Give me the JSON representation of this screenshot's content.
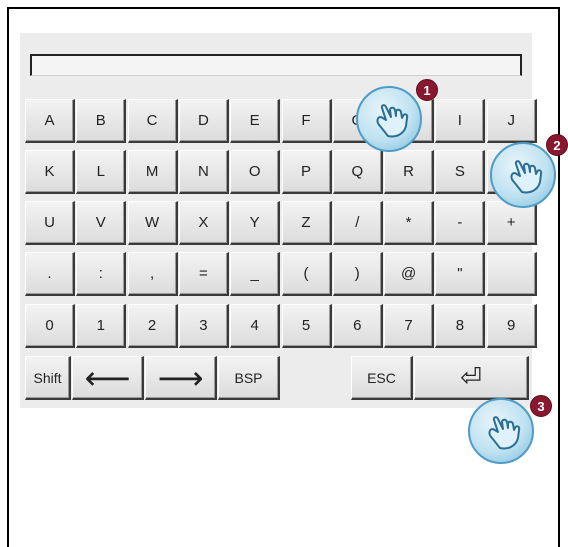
{
  "keyboard": {
    "rows": [
      [
        "A",
        "B",
        "C",
        "D",
        "E",
        "F",
        "G",
        "H",
        "I",
        "J"
      ],
      [
        "K",
        "L",
        "M",
        "N",
        "O",
        "P",
        "Q",
        "R",
        "S",
        "T"
      ],
      [
        "U",
        "V",
        "W",
        "X",
        "Y",
        "Z",
        "/",
        "*",
        "-",
        "+"
      ],
      [
        ".",
        ":",
        ",",
        "=",
        "_",
        "(",
        ")",
        "@",
        "\"",
        ""
      ],
      [
        "0",
        "1",
        "2",
        "3",
        "4",
        "5",
        "6",
        "7",
        "8",
        "9"
      ]
    ],
    "bottom_row": {
      "shift": "Shift",
      "left_arrow": "⟵",
      "right_arrow": "⟶",
      "backspace": "BSP",
      "escape": "ESC",
      "enter": "⏎"
    }
  },
  "display": {
    "value": ""
  },
  "callouts": [
    "1",
    "2",
    "3"
  ],
  "colors": {
    "badge": "#8a1730",
    "gesture": "#bfe2f1",
    "key_face": "#e6e6e6"
  },
  "icons": [
    "touch-hand-icon",
    "enter-arrow-icon"
  ]
}
